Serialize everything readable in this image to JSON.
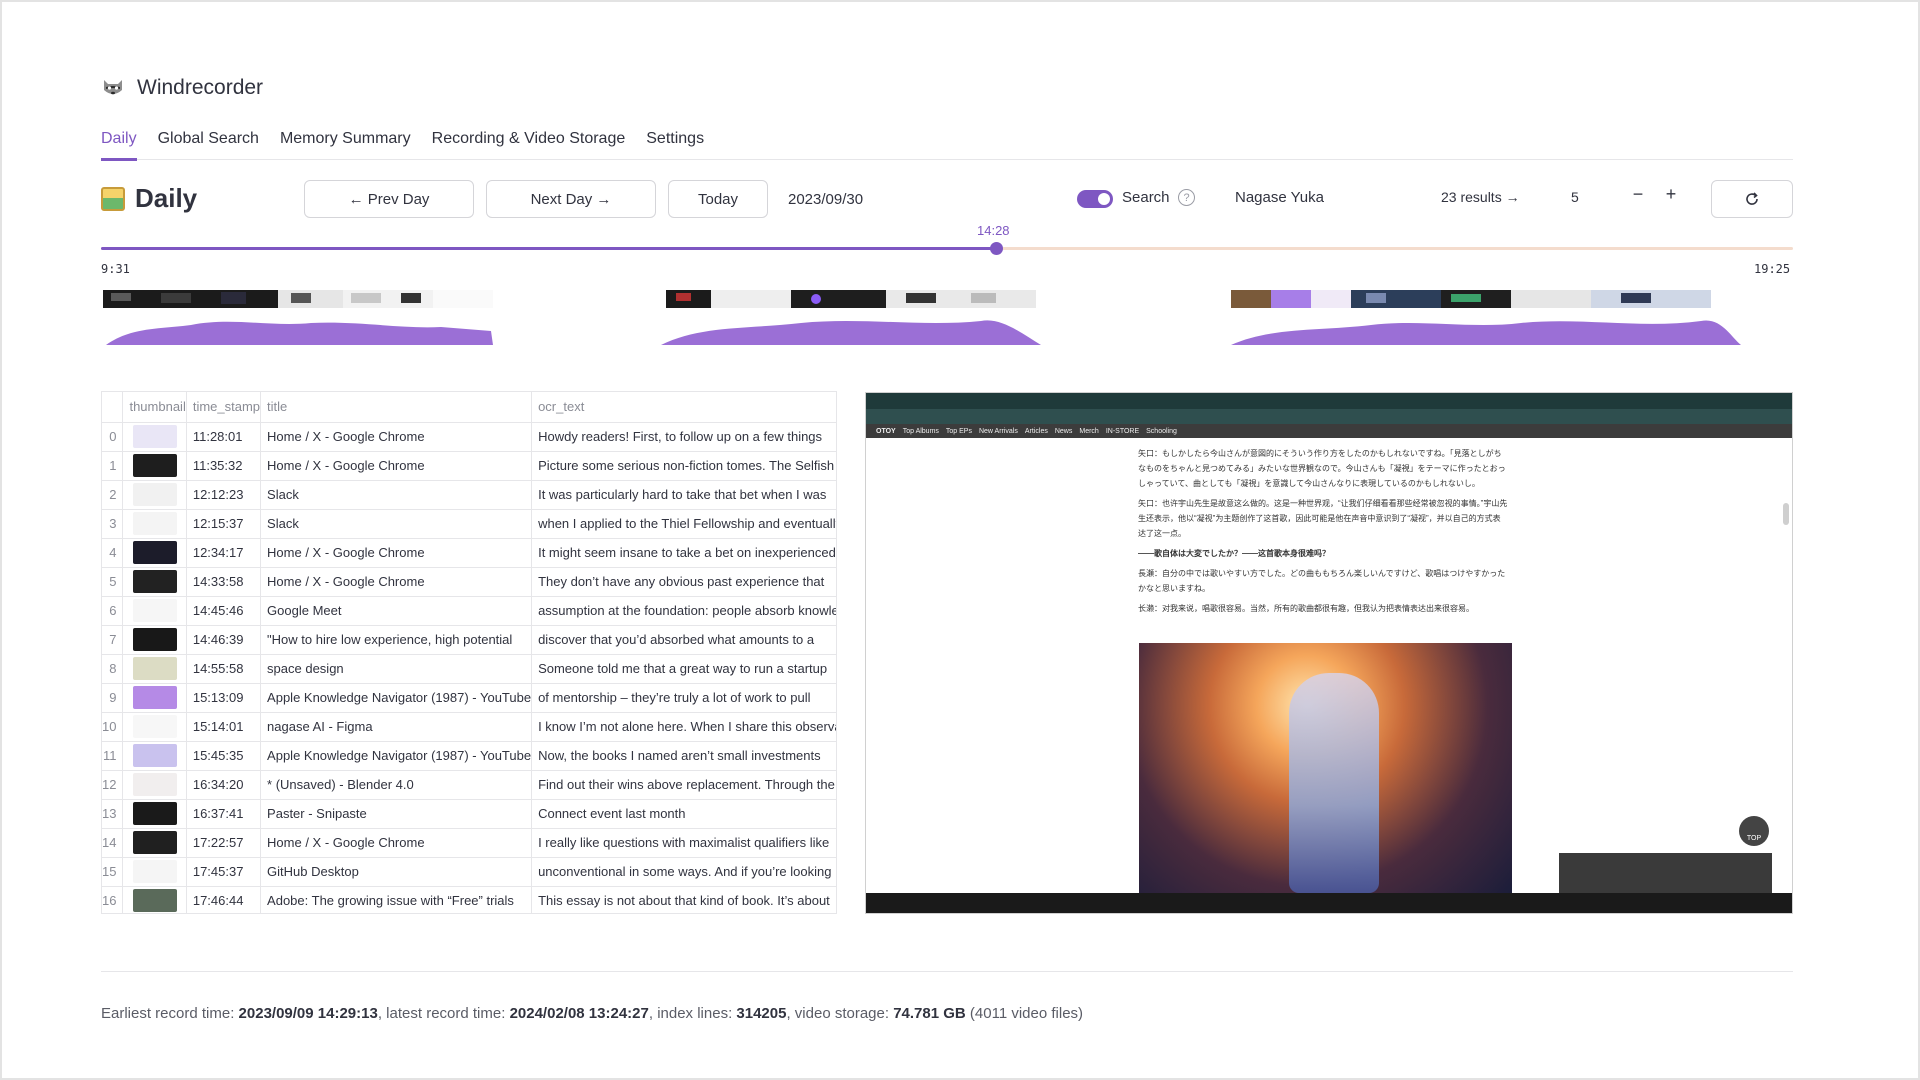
{
  "app": {
    "title": "Windrecorder",
    "logo_icon": "raccoon-icon"
  },
  "tabs": [
    {
      "label": "Daily",
      "active": true
    },
    {
      "label": "Global Search",
      "active": false
    },
    {
      "label": "Memory Summary",
      "active": false
    },
    {
      "label": "Recording & Video Storage",
      "active": false
    },
    {
      "label": "Settings",
      "active": false
    }
  ],
  "page": {
    "heading": "Daily",
    "heading_icon": "picture-icon"
  },
  "controls": {
    "prev_day": "← Prev Day",
    "next_day": "Next Day →",
    "today": "Today",
    "date": "2023/09/30",
    "search_toggle_label": "Search",
    "search_toggle_on": true,
    "search_value": "Nagase Yuka",
    "results_link": "23 results →",
    "stepper_value": "5",
    "minus": "−",
    "plus": "+",
    "refresh_icon": "refresh-icon"
  },
  "slider": {
    "min_label": "9:31",
    "max_label": "19:25",
    "current_label": "14:28",
    "fraction": 0.529
  },
  "table": {
    "columns": [
      "",
      "thumbnail",
      "time_stamp",
      "title",
      "ocr_text"
    ],
    "rows": [
      {
        "idx": "0",
        "thumb": "#e9e6f6",
        "time": "11:28:01",
        "title": "Home / X - Google Chrome",
        "ocr": "Howdy readers! First, to follow up on a few things"
      },
      {
        "idx": "1",
        "thumb": "#1e1e1e",
        "time": "11:35:32",
        "title": "Home / X - Google Chrome",
        "ocr": "Picture some serious non-fiction tomes. The Selfish"
      },
      {
        "idx": "2",
        "thumb": "#f1f1f1",
        "time": "12:12:23",
        "title": "Slack",
        "ocr": "It was particularly hard to take that bet when I was"
      },
      {
        "idx": "3",
        "thumb": "#f4f4f4",
        "time": "12:15:37",
        "title": "Slack",
        "ocr": "when I applied to the Thiel Fellowship and eventually"
      },
      {
        "idx": "4",
        "thumb": "#1c1c2a",
        "time": "12:34:17",
        "title": "Home / X - Google Chrome",
        "ocr": "It might seem insane to take a bet on inexperienced"
      },
      {
        "idx": "5",
        "thumb": "#222222",
        "time": "14:33:58",
        "title": "Home / X - Google Chrome",
        "ocr": "They don’t have any obvious past experience that"
      },
      {
        "idx": "6",
        "thumb": "#f6f6f6",
        "time": "14:45:46",
        "title": "Google Meet",
        "ocr": "assumption at the foundation: people absorb knowledge"
      },
      {
        "idx": "7",
        "thumb": "#181818",
        "time": "14:46:39",
        "title": "\"How to hire low experience, high potential",
        "ocr": "discover that you’d absorbed what amounts to a"
      },
      {
        "idx": "8",
        "thumb": "#dcdcc4",
        "time": "14:55:58",
        "title": "space design",
        "ocr": "Someone told me that a great way to run a startup"
      },
      {
        "idx": "9",
        "thumb": "#b58ae6",
        "time": "15:13:09",
        "title": "Apple Knowledge Navigator (1987) - YouTube",
        "ocr": "of mentorship – they’re truly a lot of work to pull"
      },
      {
        "idx": "10",
        "thumb": "#f7f7f7",
        "time": "15:14:01",
        "title": "nagase AI - Figma",
        "ocr": "I know I’m not alone here. When I share this observation"
      },
      {
        "idx": "11",
        "thumb": "#c9c2ee",
        "time": "15:45:35",
        "title": "Apple Knowledge Navigator (1987) - YouTube",
        "ocr": "Now, the books I named aren’t small investments"
      },
      {
        "idx": "12",
        "thumb": "#f1eeee",
        "time": "16:34:20",
        "title": "* (Unsaved) - Blender 4.0",
        "ocr": "Find out their wins above replacement. Through the"
      },
      {
        "idx": "13",
        "thumb": "#1a1a1a",
        "time": "16:37:41",
        "title": "Paster - Snipaste",
        "ocr": "Connect event last month"
      },
      {
        "idx": "14",
        "thumb": "#202020",
        "time": "17:22:57",
        "title": "Home / X - Google Chrome",
        "ocr": "I really like questions with maximalist qualifiers like"
      },
      {
        "idx": "15",
        "thumb": "#f5f5f5",
        "time": "17:45:37",
        "title": "GitHub Desktop",
        "ocr": "unconventional in some ways. And if you’re looking"
      },
      {
        "idx": "16",
        "thumb": "#5a6a5a",
        "time": "17:46:44",
        "title": "Adobe: The growing issue with “Free” trials",
        "ocr": "This essay is not about that kind of book. It’s about"
      }
    ]
  },
  "preview": {
    "nav_items": [
      "OTOY",
      "Top Albums",
      "Top EPs",
      "New Arrivals",
      "Articles",
      "News",
      "Merch",
      "IN-STORE",
      "Schooling"
    ],
    "paragraphs": [
      "矢口：もしかしたら今山さんが意図的にそういう作り方をしたのかもしれないですね。「見落としがちなものをちゃんと見つめてみる」みたいな世界観なので。今山さんも「凝視」をテーマに作ったとおっしゃっていて、曲としても「凝視」を意識して今山さんなりに表現しているのかもしれないし。",
      "矢口：也许宇山先生是故意这么做的。这是一种世界观，“让我们仔细看看那些经常被忽视的事情。”宇山先生还表示，他以“凝视”为主题创作了这首歌，因此可能是他在声音中意识到了“凝视”，并以自己的方式表达了这一点。",
      "——歌自体は大変でしたか？——这首歌本身很难吗？",
      "長瀬：自分の中では歌いやすい方でした。どの曲ももちろん楽しいんですけど、歌唱はつけやすかったかなと思いますね。",
      "长濑：对我来说，唱歌很容易。当然，所有的歌曲都很有趣，但我认为把表情表达出来很容易。"
    ],
    "top_button": "TOP"
  },
  "footer": {
    "earliest_label": "Earliest record time: ",
    "earliest_value": "2023/09/09 14:29:13",
    "latest_label": ", latest record time: ",
    "latest_value": "2024/02/08 13:24:27",
    "index_label": ", index lines: ",
    "index_value": "314205",
    "storage_label": ", video storage: ",
    "storage_value": "74.781 GB",
    "files_text": " (4011 video files)"
  },
  "colors": {
    "accent": "#7e57c2",
    "track_rest": "#f4dccd",
    "text": "#31333f"
  }
}
